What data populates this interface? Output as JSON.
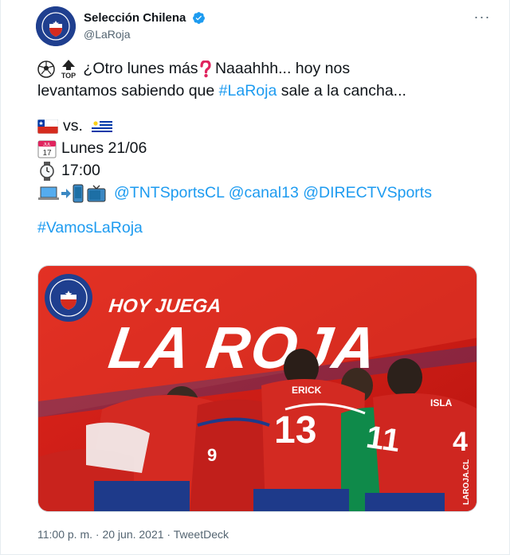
{
  "author": {
    "display_name": "Selección Chilena",
    "handle": "@LaRoja"
  },
  "tweet": {
    "line1_text": " ¿Otro lunes más",
    "line1_tail": " Naaahhh... hoy nos",
    "line2_pre": "levantamos sabiendo que ",
    "line2_hashtag": "#LaRoja",
    "line2_post": " sale a la cancha...",
    "vs_text": "vs.",
    "date_text": "Lunes 21/06",
    "time_text": "17:00",
    "mention1": "@TNTSportsCL",
    "mention2": "@canal13",
    "mention3": "@DIRECTVSports",
    "hashtag": "#VamosLaRoja"
  },
  "media": {
    "headline_small": "HOY JUEGA",
    "headline_big": "LA ROJA",
    "jersey_names": [
      "ERICK",
      "ISLA"
    ],
    "jersey_numbers": [
      "13",
      "11",
      "9",
      "4"
    ],
    "side_text": "LAROJA.CL",
    "calendar_month": "JUL",
    "calendar_day": "17"
  },
  "meta": {
    "time": "11:00 p. m.",
    "sep1": " · ",
    "date": "20 jun. 2021",
    "sep2": " · ",
    "source": "TweetDeck"
  },
  "colors": {
    "link": "#1d9bf0",
    "chile_red": "#d52b1e",
    "chile_blue": "#0039a6"
  }
}
